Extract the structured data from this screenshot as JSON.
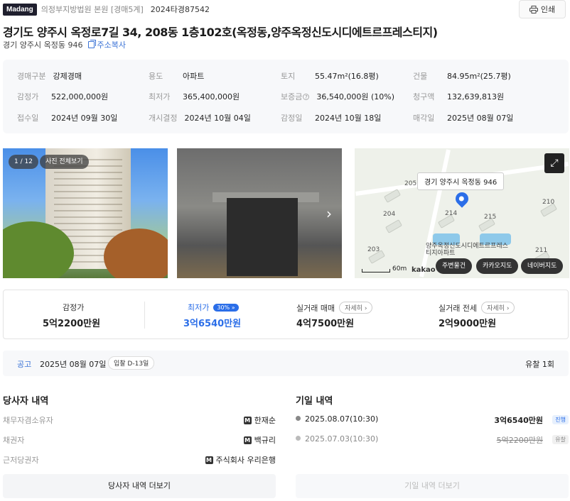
{
  "header": {
    "logo": "Madang",
    "court": "의정부지방법원 본원 [경매5계]",
    "case_no": "2024타경87542",
    "print_label": "인쇄",
    "title": "경기도 양주시 옥정로7길 34, 208동 1층102호(옥정동,양주옥정신도시디에트르프레스티지)",
    "lot_address": "경기 양주시 옥정동 946",
    "copy_label": "주소복사"
  },
  "info": [
    {
      "k": "경매구분",
      "v": "강제경매"
    },
    {
      "k": "용도",
      "v": "아파트"
    },
    {
      "k": "토지",
      "v": "55.47m²(16.8평)"
    },
    {
      "k": "건물",
      "v": "84.95m²(25.7평)"
    },
    {
      "k": "감정가",
      "v": "522,000,000원"
    },
    {
      "k": "최저가",
      "v": "365,400,000원"
    },
    {
      "k": "보증금",
      "v": "36,540,000원 (10%)"
    },
    {
      "k": "청구액",
      "v": "132,639,813원"
    },
    {
      "k": "접수일",
      "v": "2024년 09월 30일"
    },
    {
      "k": "개시결정",
      "v": "2024년 10월 04일"
    },
    {
      "k": "감정일",
      "v": "2024년 10월 18일"
    },
    {
      "k": "매각일",
      "v": "2025년 08월 07일"
    }
  ],
  "photos": {
    "counter": "1 / 12",
    "view_all": "사진 전체보기"
  },
  "map": {
    "tooltip": "경기 양주시 옥정동 946",
    "complex_name": "양주옥정신도시디에트르프레스티지아파트",
    "numbers": [
      "205",
      "204",
      "214",
      "215",
      "210",
      "203",
      "211"
    ],
    "scale": "60m",
    "brand": "kakao",
    "buttons": [
      "주변물건",
      "카카오지도",
      "네이버지도"
    ]
  },
  "prices": {
    "appraisal_label": "감정가",
    "appraisal_value": "5억2200만원",
    "minimum_label": "최저가",
    "minimum_pct": "30%",
    "minimum_value": "3억6540만원",
    "trade_label": "실거래 매매",
    "trade_value": "4억7500만원",
    "jeonse_label": "실거래 전세",
    "jeonse_value": "2억9000만원",
    "detail_label": "자세히"
  },
  "notice": {
    "label": "공고",
    "date": "2025년 08월 07일",
    "dday": "입찰 D-13일",
    "fail": "유찰 1회"
  },
  "parties": {
    "title": "당사자 내역",
    "rows": [
      {
        "k": "채무자겸소유자",
        "v": "한재순"
      },
      {
        "k": "채권자",
        "v": "백규리"
      },
      {
        "k": "근저당권자",
        "v": "주식회사 우리은행"
      }
    ],
    "more": "당사자 내역 더보기"
  },
  "history": {
    "title": "기일 내역",
    "rows": [
      {
        "date": "2025.08.07(10:30)",
        "amount": "3억6540만원",
        "status": "진행"
      },
      {
        "date": "2025.07.03(10:30)",
        "amount": "5억2200만원",
        "status": "유찰"
      }
    ],
    "more": "기일 내역 더보기"
  },
  "colors": {
    "accent": "#2b6ee8",
    "link": "#3b73d6"
  }
}
